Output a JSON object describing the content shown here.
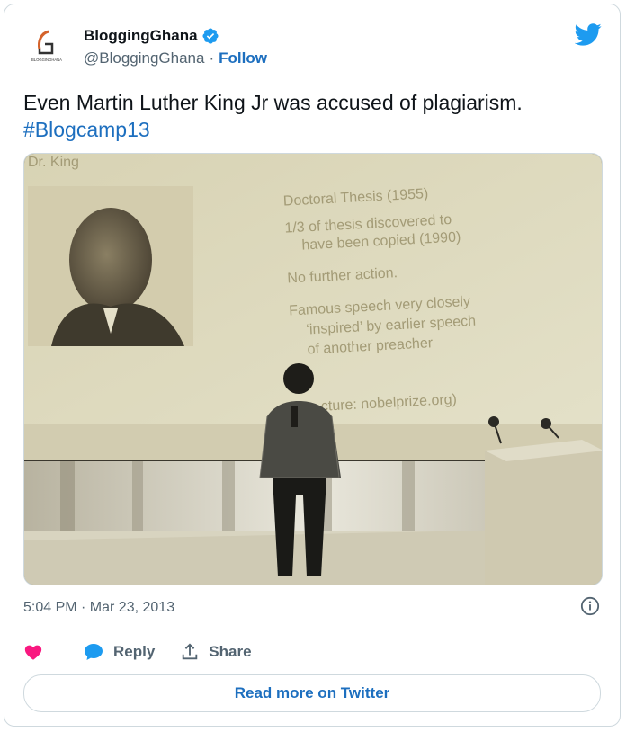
{
  "author": {
    "display_name": "BloggingGhana",
    "handle": "@BloggingGhana",
    "separator": "·",
    "follow_label": "Follow",
    "avatar_text": "BLOGGINGHANA",
    "verified": true
  },
  "tweet": {
    "text": "Even Martin Luther King Jr was accused of plagiarism.",
    "hashtag": "#Blogcamp13"
  },
  "media": {
    "slide_heading": "Dr. King",
    "bullets": [
      "Doctoral Thesis (1955)",
      "1/3 of thesis discovered to",
      "have been copied (1990)",
      "No further action.",
      "Famous speech very closely",
      "‘inspired’ by earlier speech",
      "of another preacher"
    ],
    "picture_credit": "cture: nobelprize.org)"
  },
  "meta": {
    "timestamp": "5:04 PM · Mar 23, 2013"
  },
  "actions": {
    "reply_label": "Reply",
    "share_label": "Share",
    "read_more_label": "Read more on Twitter"
  },
  "colors": {
    "link": "#1d6fbf",
    "heart": "#f91880",
    "twitter": "#1d9bf0",
    "verified": "#1d9bf0"
  },
  "icons": {
    "logo": "twitter-bird-icon",
    "info": "info-icon",
    "like": "heart-icon",
    "reply": "speech-bubble-icon",
    "share": "share-upload-icon",
    "verified": "verified-badge-icon"
  }
}
